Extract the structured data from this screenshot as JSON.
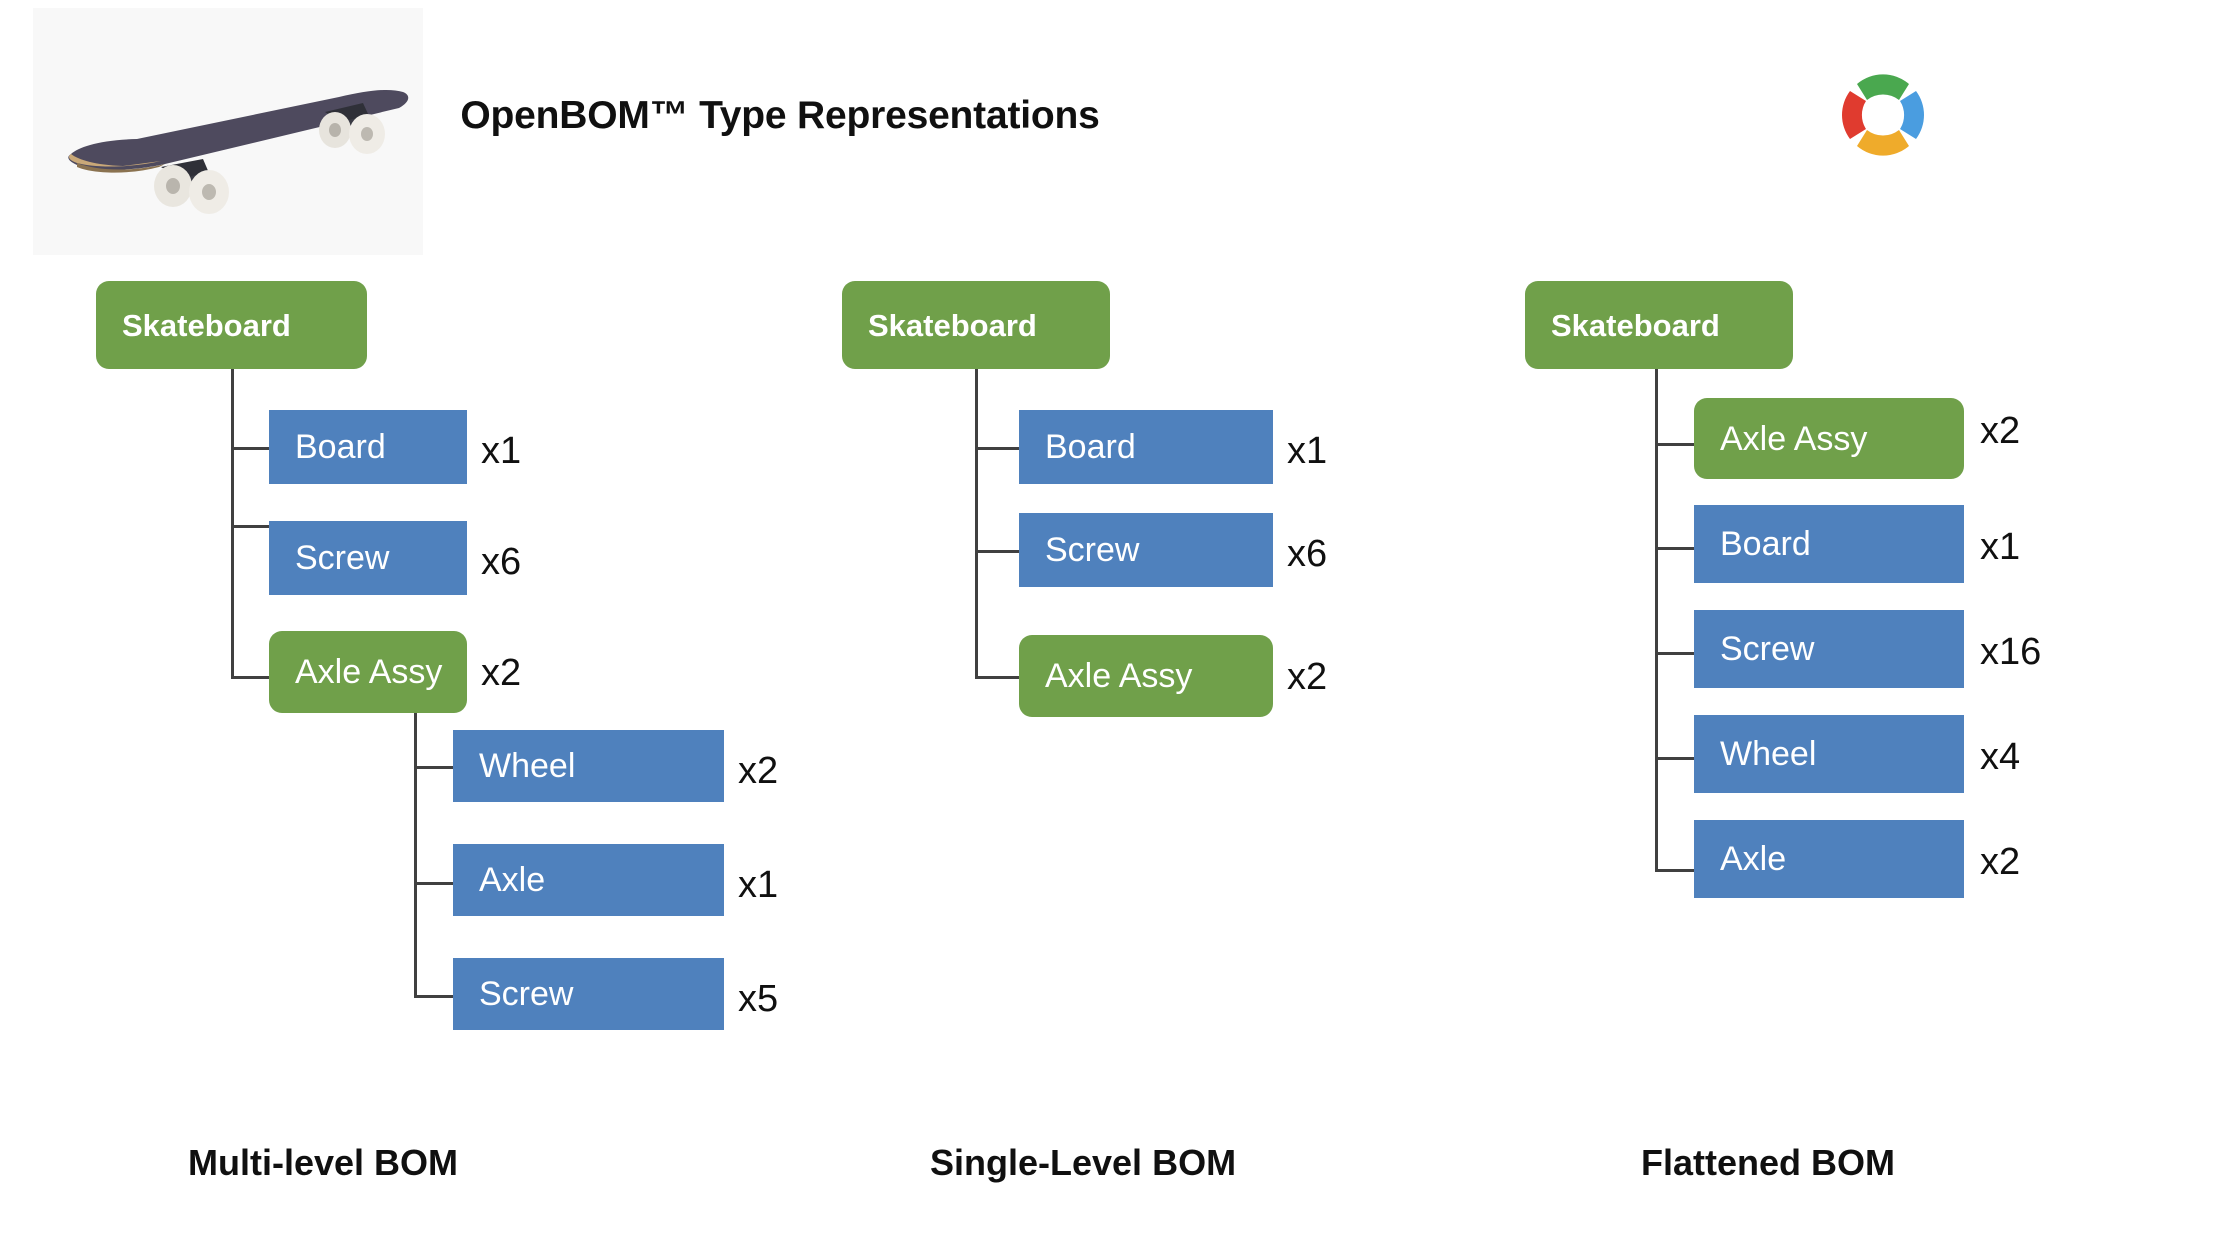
{
  "header": {
    "title": "OpenBOM™ Type Representations",
    "photo_alt": "skateboard-photo",
    "logo_alt": "openbom-ring-logo",
    "logo_colors": {
      "top": "#4aa84f",
      "right": "#4a9de0",
      "bottom": "#efab2b",
      "left": "#e03b2f"
    }
  },
  "colors": {
    "assembly": "#70a04a",
    "part": "#4f81bd",
    "connector": "#404040",
    "text_on_box": "#ffffff",
    "qty_text": "#101010",
    "background": "#ffffff"
  },
  "columns": [
    {
      "id": "multi-level",
      "caption": "Multi-level BOM",
      "root": {
        "label": "Skateboard",
        "type": "assembly"
      },
      "children": [
        {
          "label": "Board",
          "qty": "x1",
          "type": "part"
        },
        {
          "label": "Screw",
          "qty": "x6",
          "type": "part"
        },
        {
          "label": "Axle Assy",
          "qty": "x2",
          "type": "assembly"
        }
      ],
      "grandchildren": [
        {
          "label": "Wheel",
          "qty": "x2",
          "type": "part"
        },
        {
          "label": "Axle",
          "qty": "x1",
          "type": "part"
        },
        {
          "label": "Screw",
          "qty": "x5",
          "type": "part"
        }
      ]
    },
    {
      "id": "single-level",
      "caption": "Single-Level BOM",
      "root": {
        "label": "Skateboard",
        "type": "assembly"
      },
      "children": [
        {
          "label": "Board",
          "qty": "x1",
          "type": "part"
        },
        {
          "label": "Screw",
          "qty": "x6",
          "type": "part"
        },
        {
          "label": "Axle Assy",
          "qty": "x2",
          "type": "assembly"
        }
      ],
      "grandchildren": []
    },
    {
      "id": "flattened",
      "caption": "Flattened BOM",
      "root": {
        "label": "Skateboard",
        "type": "assembly"
      },
      "children": [
        {
          "label": "Axle Assy",
          "qty": "x2",
          "type": "assembly"
        },
        {
          "label": "Board",
          "qty": "x1",
          "type": "part"
        },
        {
          "label": "Screw",
          "qty": "x16",
          "type": "part"
        },
        {
          "label": "Wheel",
          "qty": "x4",
          "type": "part"
        },
        {
          "label": "Axle",
          "qty": "x2",
          "type": "part"
        }
      ],
      "grandchildren": []
    }
  ]
}
